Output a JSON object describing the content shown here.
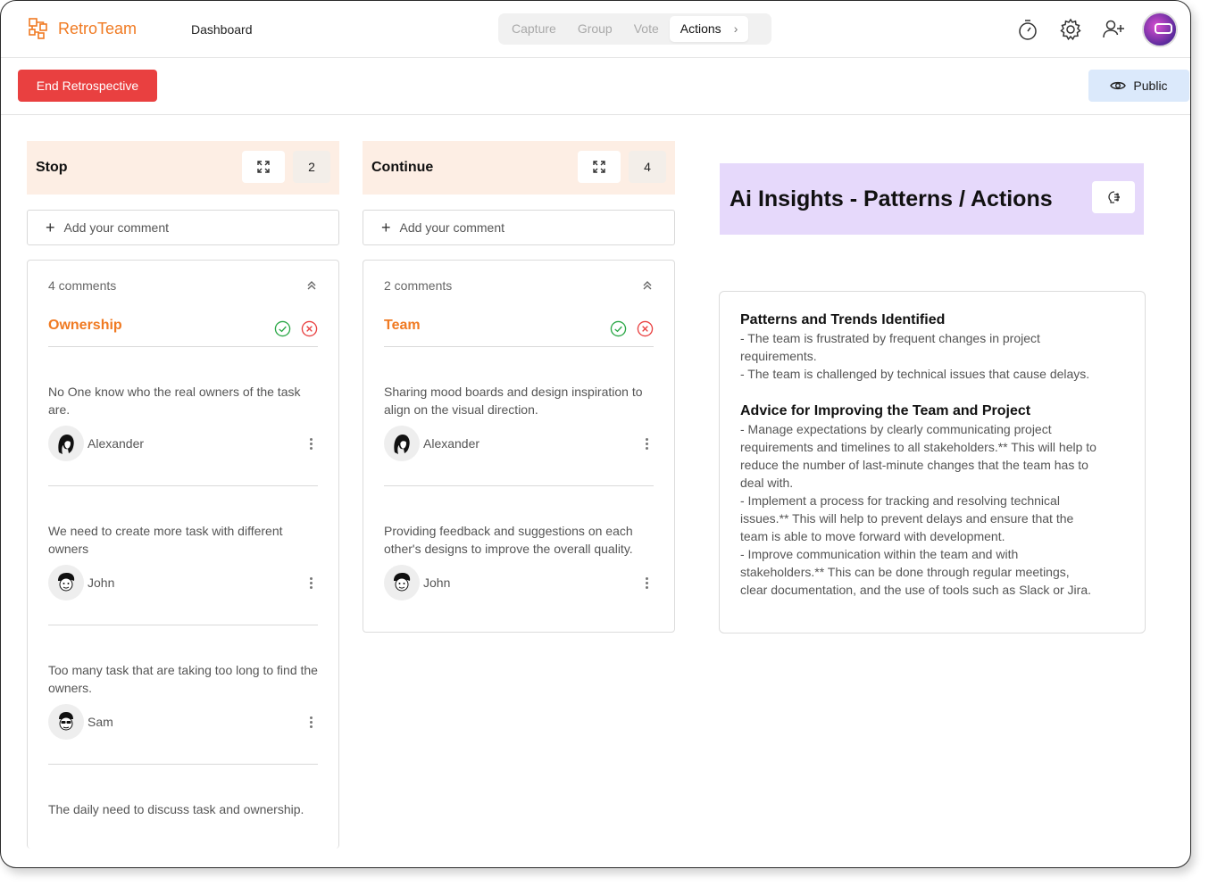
{
  "app": {
    "name": "RetroTeam",
    "nav_dashboard": "Dashboard"
  },
  "steps": [
    {
      "label": "Capture"
    },
    {
      "label": "Group"
    },
    {
      "label": "Vote"
    },
    {
      "label": "Actions"
    }
  ],
  "toolbar": {
    "end_label": "End Retrospective",
    "public_label": "Public"
  },
  "columns": [
    {
      "title": "Stop",
      "count": "2",
      "add_placeholder": "Add your comment",
      "group": {
        "count_text": "4 comments",
        "name": "Ownership",
        "comments": [
          {
            "text": "No One know who the real owners of the task are.",
            "author": "Alexander"
          },
          {
            "text": "We need to create more task with different owners",
            "author": "John"
          },
          {
            "text": "Too many task that are taking too long to find the owners.",
            "author": "Sam"
          },
          {
            "text": "The daily need to discuss task and ownership.",
            "author": ""
          }
        ]
      }
    },
    {
      "title": "Continue",
      "count": "4",
      "add_placeholder": "Add your comment",
      "group": {
        "count_text": "2 comments",
        "name": "Team",
        "comments": [
          {
            "text": "Sharing mood boards and design inspiration to align on the visual direction.",
            "author": "Alexander"
          },
          {
            "text": "Providing feedback and suggestions on each other's designs to improve the overall quality.",
            "author": "John"
          }
        ]
      }
    }
  ],
  "ai": {
    "title": "Ai Insights - Patterns / Actions",
    "section1_title": "Patterns and Trends Identified",
    "section1_lines": [
      "- The team is frustrated by frequent changes in project",
      "requirements.",
      "- The team is challenged by technical issues that cause delays."
    ],
    "section2_title": "Advice for Improving the Team and Project",
    "section2_lines": [
      "- Manage expectations by clearly communicating project",
      "requirements and timelines to all stakeholders.** This will help to",
      "reduce the number of last-minute changes that the team has to",
      "deal with.",
      "- Implement a process for tracking and resolving technical",
      "issues.** This will help to prevent delays and ensure that the",
      "team is able to move forward with development.",
      "- Improve communication within the team and with",
      "stakeholders.** This can be done through regular meetings,",
      "clear documentation, and the use of tools such as Slack or Jira."
    ]
  },
  "colors": {
    "accent": "#f07a22",
    "danger": "#e94040",
    "column_header": "#fdeee4",
    "ai_header": "#e6d9fb",
    "public": "#dbe9fb"
  }
}
